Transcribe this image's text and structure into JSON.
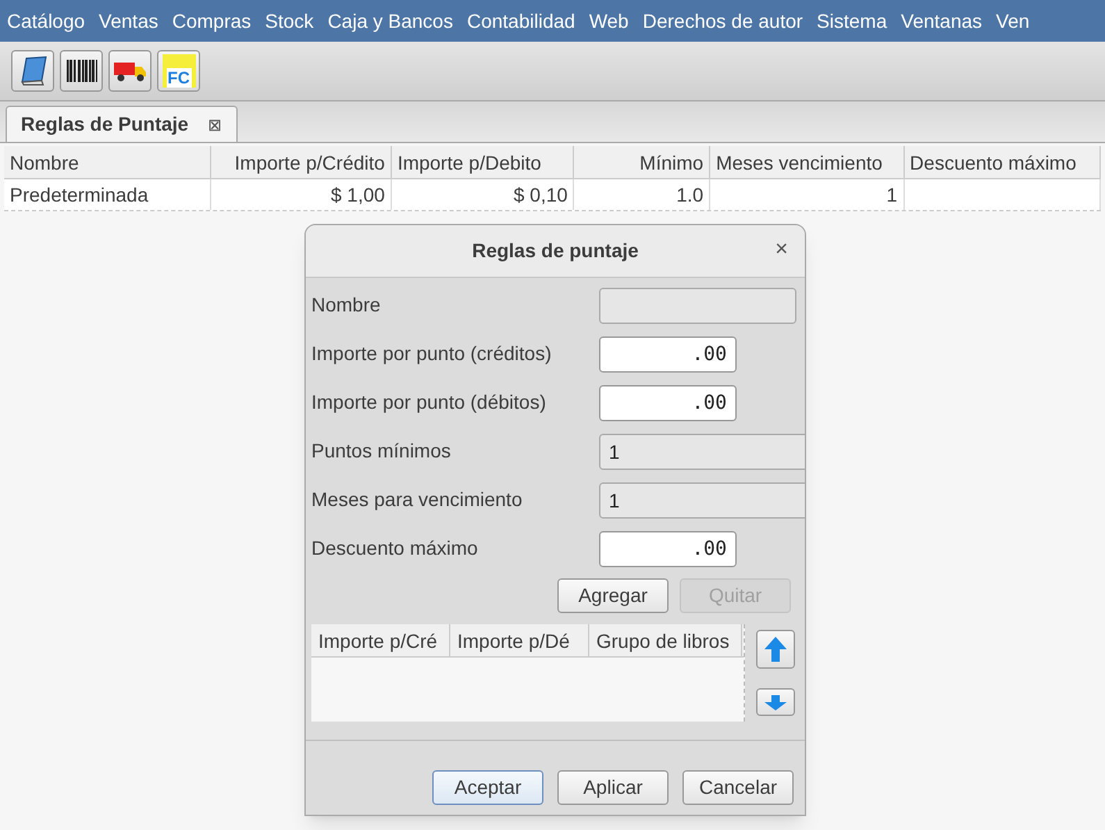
{
  "menu_bar": [
    "Catálogo",
    "Ventas",
    "Compras",
    "Stock",
    "Caja y Bancos",
    "Contabilidad",
    "Web",
    "Derechos de autor",
    "Sistema",
    "Ventanas",
    "Ven"
  ],
  "toolbar": [
    {
      "kind": "book"
    },
    {
      "kind": "barcode"
    },
    {
      "kind": "truck"
    },
    {
      "kind": "invoice",
      "label": "FC"
    }
  ],
  "tab": {
    "label": "Reglas de Puntaje",
    "close": "⊠"
  },
  "table": {
    "columns": [
      "Nombre",
      "Importe p/Crédito",
      "Importe p/Debito",
      "Mínimo",
      "Meses vencimiento",
      "Descuento máximo"
    ],
    "rows": [
      {
        "cells": [
          "Predeterminada",
          "$ 1,00",
          "$ 0,10",
          "1.0",
          "1",
          ""
        ]
      }
    ]
  },
  "dialog": {
    "title": "Reglas de puntaje",
    "close": "×",
    "fields": [
      {
        "label": "Nombre",
        "kind": "text"
      },
      {
        "label": "Importe por punto (créditos)",
        "kind": "amount",
        "value": ".00"
      },
      {
        "label": "Importe por punto (débitos)",
        "kind": "amount",
        "value": ".00"
      },
      {
        "label": "Puntos mínimos",
        "kind": "count",
        "value": "1"
      },
      {
        "label": "Meses para vencimiento",
        "kind": "count",
        "value": "1"
      },
      {
        "label": "Descuento máximo",
        "kind": "amount",
        "value": ".00"
      }
    ],
    "row_buttons": [
      {
        "label": "Agregar",
        "disabled": false
      },
      {
        "label": "Quitar",
        "disabled": true
      }
    ],
    "table": {
      "columns": [
        "Importe p/Cré",
        "Importe p/Dé",
        "Grupo de libros"
      ]
    },
    "footer_buttons": [
      {
        "label": "Aceptar",
        "default": true
      },
      {
        "label": "Aplicar",
        "default": false
      },
      {
        "label": "Cancelar",
        "default": false
      }
    ]
  }
}
